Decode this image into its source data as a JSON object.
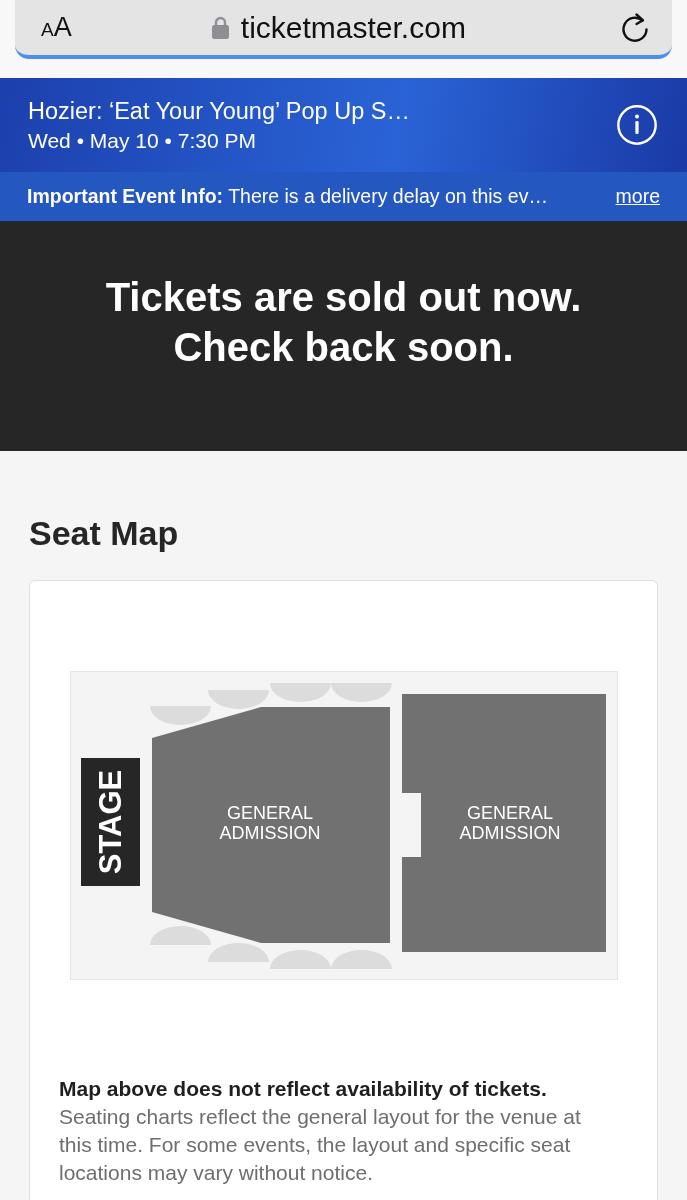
{
  "browser": {
    "text_size_button": "AA",
    "url": "ticketmaster.com"
  },
  "event": {
    "title": "Hozier: ‘Eat Your Young’ Pop Up S…",
    "date": "Wed • May 10 • 7:30 PM"
  },
  "info_banner": {
    "text": "**Important Event Info:** There is a delivery delay on this ev…",
    "link": "more"
  },
  "sold_out": {
    "lines": [
      "Tickets are sold out now.",
      "Check back soon."
    ]
  },
  "seat_map": {
    "heading": "Seat Map",
    "stage": "STAGE",
    "sections": [
      {
        "label_lines": [
          "GENERAL",
          "ADMISSION"
        ]
      },
      {
        "label_lines": [
          "GENERAL",
          "ADMISSION"
        ]
      }
    ],
    "disclaimer_title": "Map above does not reflect availability of tickets.",
    "disclaimer_text": "Seating charts reflect the general layout for the venue at this time. For some events, the layout and specific seat locations may vary without notice."
  }
}
